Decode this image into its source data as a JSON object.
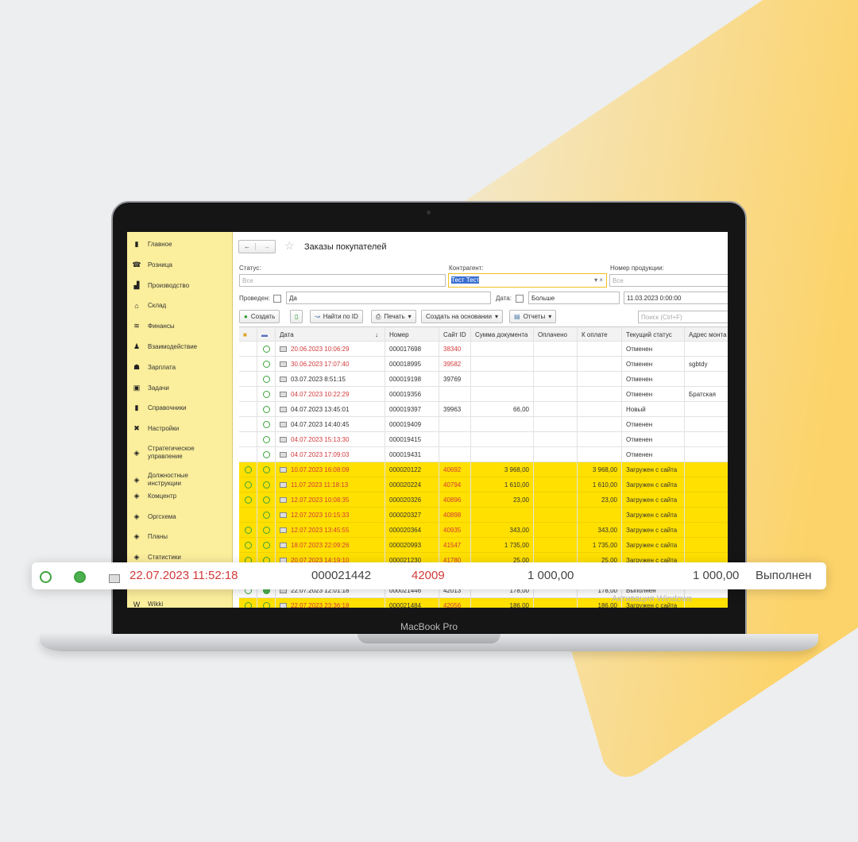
{
  "device_label": "MacBook Pro",
  "colors": {
    "accent": "#ffe000",
    "sidebar": "#fbee9c",
    "red_text": "#d23a3a",
    "status_green": "#3ea33e"
  },
  "sidebar": {
    "items": [
      {
        "label": "Главное",
        "icon": "book-icon"
      },
      {
        "label": "Розница",
        "icon": "retail-icon"
      },
      {
        "label": "Производство",
        "icon": "factory-icon"
      },
      {
        "label": "Склад",
        "icon": "warehouse-icon"
      },
      {
        "label": "Финансы",
        "icon": "coins-icon"
      },
      {
        "label": "Взаимодействие",
        "icon": "person-icon"
      },
      {
        "label": "Зарплата",
        "icon": "people-icon"
      },
      {
        "label": "Задачи",
        "icon": "tasks-icon"
      },
      {
        "label": "Справочники",
        "icon": "book-icon"
      },
      {
        "label": "Настройки",
        "icon": "tools-icon"
      },
      {
        "label": "Стратегическое управление",
        "icon": "diamond-icon"
      },
      {
        "label": "Должностные инструкции",
        "icon": "diamond-icon"
      },
      {
        "label": "Комцентр",
        "icon": "diamond-icon"
      },
      {
        "label": "Оргсхема",
        "icon": "diamond-icon"
      },
      {
        "label": "Планы",
        "icon": "diamond-icon"
      },
      {
        "label": "Статистики",
        "icon": "diamond-icon"
      },
      {
        "label": "Wikki",
        "icon": "wiki-icon"
      }
    ]
  },
  "header": {
    "title": "Заказы покупателей",
    "back": "←",
    "forward": "→"
  },
  "filters": {
    "status_label": "Статус:",
    "status_placeholder": "Все",
    "contractor_label": "Контрагент:",
    "contractor_value": "Тест Тест",
    "product_label": "Номер продукции:",
    "product_placeholder": "Все",
    "posted_label": "Проведен:",
    "posted_value": "Да",
    "date_label": "Дата:",
    "date_condition": "Больше",
    "date_value": "11.03.2023  0:00:00"
  },
  "toolbar": {
    "create": "Создать",
    "find_by_id": "Найти по ID",
    "print": "Печать",
    "create_based": "Создать на основании",
    "reports": "Отчеты",
    "search_placeholder": "Поиск (Ctrl+F)"
  },
  "table": {
    "columns": [
      "",
      "",
      "Дата",
      "Номер",
      "Сайт ID",
      "Сумма документа",
      "Оплачено",
      "К оплате",
      "Текущий статус",
      "Адрес монта"
    ],
    "rows": [
      {
        "c1": "",
        "c2": "o",
        "date": "20.06.2023 10:06:29",
        "red": true,
        "num": "000017698",
        "site": "38340",
        "sum": "",
        "paid": "",
        "due": "",
        "status": "Отменен",
        "addr": "",
        "y": false
      },
      {
        "c1": "",
        "c2": "o",
        "date": "30.06.2023 17:07:40",
        "red": true,
        "num": "000018995",
        "site": "39582",
        "sum": "",
        "paid": "",
        "due": "",
        "status": "Отменен",
        "addr": "sgbtdy",
        "y": false
      },
      {
        "c1": "",
        "c2": "o",
        "date": "03.07.2023 8:51:15",
        "red": false,
        "num": "000019198",
        "site": "39769",
        "sum": "",
        "paid": "",
        "due": "",
        "status": "Отменен",
        "addr": "",
        "y": false
      },
      {
        "c1": "",
        "c2": "o",
        "date": "04.07.2023 10:22:29",
        "red": true,
        "num": "000019356",
        "site": "",
        "sum": "",
        "paid": "",
        "due": "",
        "status": "Отменен",
        "addr": "Братская",
        "y": false
      },
      {
        "c1": "",
        "c2": "o",
        "date": "04.07.2023 13:45:01",
        "red": false,
        "num": "000019397",
        "site": "39963",
        "sum": "66,00",
        "paid": "",
        "due": "",
        "status": "Новый",
        "addr": "",
        "y": false
      },
      {
        "c1": "",
        "c2": "o",
        "date": "04.07.2023 14:40:45",
        "red": false,
        "num": "000019409",
        "site": "",
        "sum": "",
        "paid": "",
        "due": "",
        "status": "Отменен",
        "addr": "",
        "y": false
      },
      {
        "c1": "",
        "c2": "o",
        "date": "04.07.2023 15:13:30",
        "red": true,
        "num": "000019415",
        "site": "",
        "sum": "",
        "paid": "",
        "due": "",
        "status": "Отменен",
        "addr": "",
        "y": false
      },
      {
        "c1": "",
        "c2": "o",
        "date": "04.07.2023 17:09:03",
        "red": true,
        "num": "000019431",
        "site": "",
        "sum": "",
        "paid": "",
        "due": "",
        "status": "Отменен",
        "addr": "",
        "y": false
      },
      {
        "c1": "o",
        "c2": "o",
        "date": "10.07.2023 16:08:09",
        "red": true,
        "num": "000020122",
        "site": "40692",
        "sum": "3 968,00",
        "paid": "",
        "due": "3 968,00",
        "status": "Загружен с сайта",
        "addr": "",
        "y": true
      },
      {
        "c1": "o",
        "c2": "o",
        "date": "11.07.2023 11:18:13",
        "red": true,
        "num": "000020224",
        "site": "40794",
        "sum": "1 610,00",
        "paid": "",
        "due": "1 610,00",
        "status": "Загружен с сайта",
        "addr": "",
        "y": true
      },
      {
        "c1": "o",
        "c2": "o",
        "date": "12.07.2023 10:08:35",
        "red": true,
        "num": "000020326",
        "site": "40896",
        "sum": "23,00",
        "paid": "",
        "due": "23,00",
        "status": "Загружен с сайта",
        "addr": "",
        "y": true
      },
      {
        "c1": "",
        "c2": "o",
        "date": "12.07.2023 10:15:33",
        "red": true,
        "num": "000020327",
        "site": "40898",
        "sum": "",
        "paid": "",
        "due": "",
        "status": "Загружен с сайта",
        "addr": "",
        "y": true
      },
      {
        "c1": "o",
        "c2": "o",
        "date": "12.07.2023 13:45:55",
        "red": true,
        "num": "000020364",
        "site": "40935",
        "sum": "343,00",
        "paid": "",
        "due": "343,00",
        "status": "Загружен с сайта",
        "addr": "",
        "y": true
      },
      {
        "c1": "o",
        "c2": "o",
        "date": "18.07.2023 22:09:26",
        "red": true,
        "num": "000020993",
        "site": "41547",
        "sum": "1 735,00",
        "paid": "",
        "due": "1 735,00",
        "status": "Загружен с сайта",
        "addr": "",
        "y": true
      },
      {
        "c1": "o",
        "c2": "o",
        "date": "20.07.2023 14:19:10",
        "red": true,
        "num": "000021230",
        "site": "41780",
        "sum": "25,00",
        "paid": "",
        "due": "25,00",
        "status": "Загружен с сайта",
        "addr": "",
        "y": true
      },
      {
        "c1": "o",
        "c2": "f",
        "date": "22.07.2023 11:52:18",
        "red": true,
        "num": "000021442",
        "site": "42009",
        "sum": "1 000,00",
        "paid": "",
        "due": "1 000,00",
        "status": "Выполнен",
        "addr": "",
        "y": false
      },
      {
        "c1": "o",
        "c2": "f",
        "date": "22.07.2023 12:01:18",
        "red": false,
        "num": "000021446",
        "site": "42013",
        "sum": "178,00",
        "paid": "",
        "due": "178,00",
        "status": "Выполнен",
        "addr": "",
        "y": false
      },
      {
        "c1": "o",
        "c2": "o",
        "date": "22.07.2023 23:36:18",
        "red": true,
        "num": "000021484",
        "site": "42056",
        "sum": "186,00",
        "paid": "",
        "due": "186,00",
        "status": "Загружен с сайта",
        "addr": "",
        "y": true
      }
    ]
  },
  "highlight": {
    "date": "22.07.2023 11:52:18",
    "num": "000021442",
    "site": "42009",
    "sum": "1 000,00",
    "due": "1 000,00",
    "status": "Выполнен"
  },
  "watermark": "Активация Windows"
}
